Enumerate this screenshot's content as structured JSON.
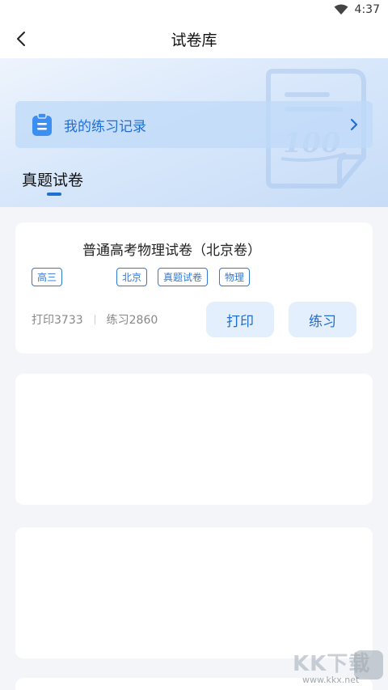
{
  "status_bar": {
    "time": "4:37",
    "wifi_icon": "wifi-icon"
  },
  "app_bar": {
    "title": "试卷库",
    "back_icon": "back-arrow-icon"
  },
  "hero": {
    "record": {
      "label": "我的练习记录",
      "icon": "clipboard-icon",
      "chevron": "chevron-right-icon"
    },
    "section_title": "真题试卷"
  },
  "papers": [
    {
      "title": "普通高考物理试卷（北京卷）",
      "tags": [
        "高三",
        "北京",
        "真题试卷",
        "物理"
      ],
      "print_stat": "打印3733",
      "practice_stat": "练习2860",
      "print_label": "打印",
      "practice_label": "练习"
    }
  ],
  "watermark": {
    "text": "KK下载",
    "url": "www.kkx.net"
  },
  "colors": {
    "accent": "#1f6ed4",
    "button_bg": "#e3effc",
    "background": "#f3f5f8"
  }
}
